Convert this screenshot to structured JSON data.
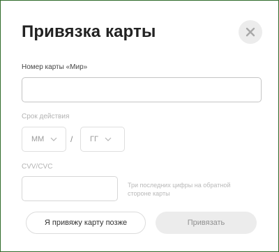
{
  "dialog": {
    "title": "Привязка карты"
  },
  "card_number": {
    "label": "Номер карты «Мир»",
    "value": ""
  },
  "expiry": {
    "label": "Срок действия",
    "month_placeholder": "ММ",
    "separator": "/",
    "year_placeholder": "ГГ"
  },
  "cvv": {
    "label": "CVV/CVC",
    "value": "",
    "hint": "Три последних цифры на обратной стороне карты"
  },
  "buttons": {
    "later_label": "Я привяжу карту позже",
    "bind_label": "Привязать"
  },
  "colors": {
    "frame_border": "#2f6b2a",
    "disabled_button_bg": "#ececec",
    "close_button_bg": "#ececec"
  },
  "icons": {
    "close": "close-icon",
    "dropdown": "chevron-down-icon"
  }
}
